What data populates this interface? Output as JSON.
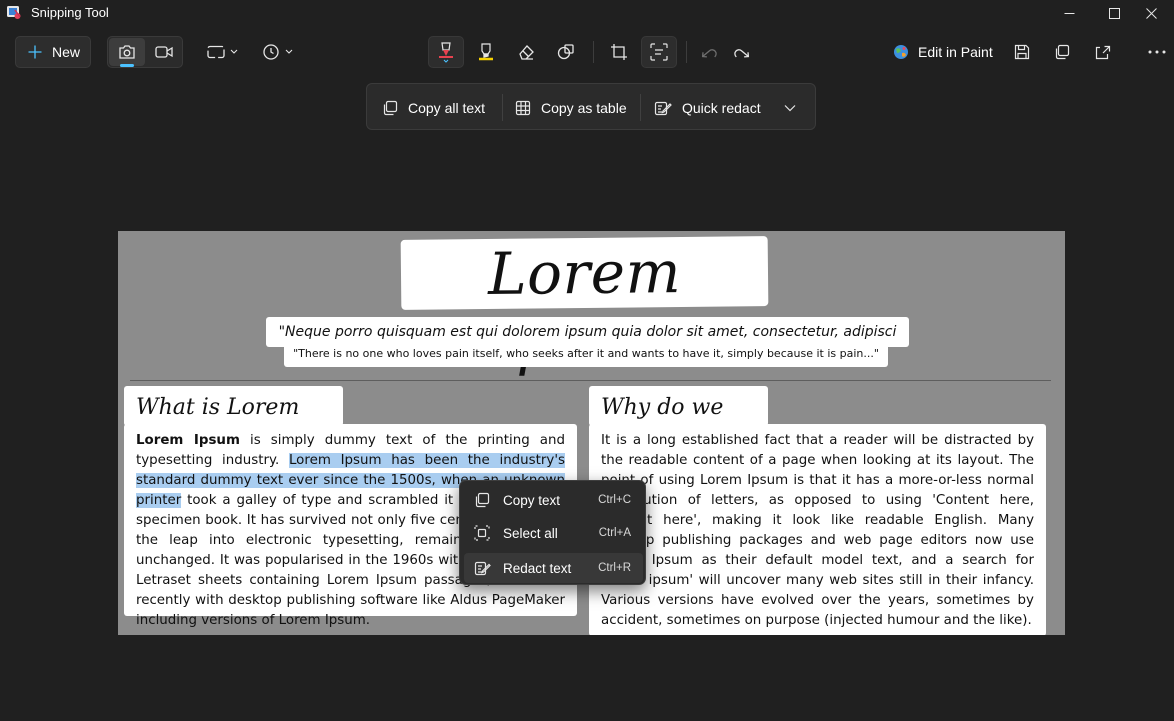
{
  "app": {
    "title": "Snipping Tool",
    "accent": "#4cc2ff",
    "icon": "snipping-tool-app-icon"
  },
  "window_controls": [
    "minimize-icon",
    "maximize-icon",
    "close-icon"
  ],
  "toolbar": {
    "new_label": "New",
    "modes": [
      "camera-icon",
      "video-icon"
    ],
    "snip_shape_icon": "rectangle-snip-icon",
    "delay_icon": "clock-icon",
    "tools": [
      "ballpoint-pen-icon",
      "highlighter-icon",
      "eraser-icon",
      "shapes-icon",
      "crop-icon",
      "text-actions-icon"
    ],
    "undo_icon": "undo-icon",
    "redo_icon": "redo-icon",
    "edit_in_paint_label": "Edit in Paint",
    "right_icons": [
      "save-icon",
      "copy-icon",
      "share-icon",
      "more-icon"
    ]
  },
  "text_actions": {
    "copy_all_text": "Copy all text",
    "copy_as_table": "Copy as table",
    "quick_redact": "Quick redact"
  },
  "snip": {
    "title": "Lorem Ipsum",
    "quote": "\"Neque porro quisquam est qui dolorem ipsum quia dolor sit amet, consectetur, adipisci velit...\"",
    "quote_translation": "\"There is no one who loves pain itself, who seeks after it and wants to have it, simply because it is pain...\"",
    "left_heading": "What is Lorem Ipsum?",
    "left_bold": "Lorem Ipsum",
    "left_text_1": " is simply dummy text of the printing and typesetting industry. ",
    "left_highlight": "Lorem Ipsum has been the industry's standard dummy text ever since the 1500s, when an unknown printer",
    "left_text_2": " took a galley of type and scrambled it to make a type specimen book. It has survived not only five centuries, but also the leap into electronic typesetting, remaining essentially unchanged. It was popularised in the 1960s with the release of Letraset sheets containing Lorem Ipsum passages, and more recently with desktop publishing software like Aldus PageMaker including versions of Lorem Ipsum.",
    "right_heading": "Why do we use it?",
    "right_text": "It is a long established fact that a reader will be distracted by the readable content of a page when looking at its layout. The point of using Lorem Ipsum is that it has a more-or-less normal distribution of letters, as opposed to using 'Content here, content here', making it look like readable English. Many desktop publishing packages and web page editors now use Lorem Ipsum as their default model text, and a search for 'lorem ipsum' will uncover many web sites still in their infancy. Various versions have evolved over the years, sometimes by accident, sometimes on purpose (injected humour and the like)."
  },
  "context_menu": {
    "items": [
      {
        "label": "Copy text",
        "shortcut": "Ctrl+C",
        "icon": "copy-icon"
      },
      {
        "label": "Select all",
        "shortcut": "Ctrl+A",
        "icon": "select-all-icon"
      },
      {
        "label": "Redact text",
        "shortcut": "Ctrl+R",
        "icon": "redact-icon"
      }
    ]
  }
}
